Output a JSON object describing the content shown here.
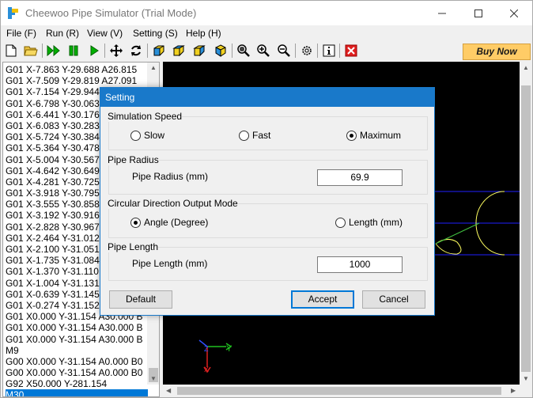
{
  "window": {
    "title": "Cheewoo Pipe Simulator (Trial Mode)"
  },
  "menu": [
    "File (F)",
    "Run (R)",
    "View (V)",
    "Setting (S)",
    "Help (H)"
  ],
  "toolbar": {
    "icons": [
      "new-file-icon",
      "open-folder-icon",
      "run-all-icon",
      "pause-icon",
      "play-icon",
      "move-icon",
      "rotate-icon",
      "cube-front-icon",
      "cube-top-icon",
      "cube-side-icon",
      "cube-iso-icon",
      "zoom-fit-icon",
      "zoom-in-icon",
      "zoom-out-icon",
      "settings-icon",
      "info-icon",
      "close-red-icon"
    ],
    "buy_now": "Buy Now"
  },
  "code": {
    "lines": [
      "G01 X-7.863 Y-29.688 A26.815",
      "G01 X-7.509 Y-29.819 A27.091",
      "G01 X-7.154 Y-29.944",
      "G01 X-6.798 Y-30.063",
      "G01 X-6.441 Y-30.176",
      "G01 X-6.083 Y-30.283",
      "G01 X-5.724 Y-30.384",
      "G01 X-5.364 Y-30.478",
      "G01 X-5.004 Y-30.567",
      "G01 X-4.642 Y-30.649",
      "G01 X-4.281 Y-30.725",
      "G01 X-3.918 Y-30.795",
      "G01 X-3.555 Y-30.858",
      "G01 X-3.192 Y-30.916",
      "G01 X-2.828 Y-30.967",
      "G01 X-2.464 Y-31.012",
      "G01 X-2.100 Y-31.051",
      "G01 X-1.735 Y-31.084",
      "G01 X-1.370 Y-31.110",
      "G01 X-1.004 Y-31.131",
      "G01 X-0.639 Y-31.145",
      "G01 X-0.274 Y-31.152",
      "G01 X0.000 Y-31.154 A30.000 B",
      "G01 X0.000 Y-31.154 A30.000 B",
      "G01 X0.000 Y-31.154 A30.000 B",
      "M9",
      "G00 X0.000 Y-31.154 A0.000 B0",
      "G00 X0.000 Y-31.154 A0.000 B0",
      "G92 X50.000 Y-281.154",
      "M30"
    ],
    "selected_index": 29
  },
  "axes": {
    "y_label": "Y",
    "z_label": "Z",
    "x_label": "X"
  },
  "dialog": {
    "title": "Setting",
    "speed": {
      "label": "Simulation Speed",
      "options": [
        "Slow",
        "Fast",
        "Maximum"
      ],
      "selected": "Maximum"
    },
    "radius": {
      "label": "Pipe Radius",
      "field_label": "Pipe Radius (mm)",
      "value": "69.9"
    },
    "circ": {
      "label": "Circular Direction Output Mode",
      "options": [
        "Angle (Degree)",
        "Length (mm)"
      ],
      "selected": "Angle (Degree)"
    },
    "length": {
      "label": "Pipe Length",
      "field_label": "Pipe Length (mm)",
      "value": "1000"
    },
    "buttons": {
      "default": "Default",
      "accept": "Accept",
      "cancel": "Cancel"
    }
  },
  "colors": {
    "accent": "#1979ca",
    "buy": "#ffcc66",
    "pipe_line": "#2020ff",
    "curve": "#ffff60"
  }
}
